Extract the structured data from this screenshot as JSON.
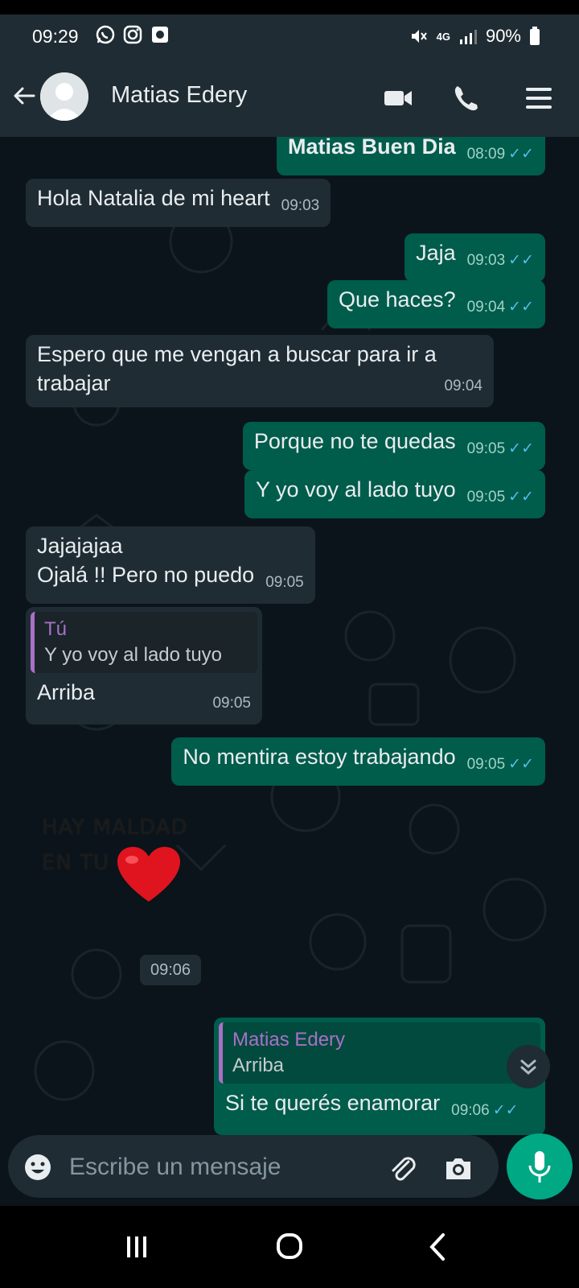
{
  "status_bar": {
    "time": "09:29",
    "network": "4G",
    "battery": "90%"
  },
  "header": {
    "contact_name": "Matias Edery"
  },
  "messages": [
    {
      "id": "m0",
      "direction": "out",
      "text": "Matias Buen Dia",
      "time": "08:09",
      "read": true
    },
    {
      "id": "m1",
      "direction": "in",
      "text": "Hola Natalia de mi heart",
      "time": "09:03"
    },
    {
      "id": "m2",
      "direction": "out",
      "text": "Jaja",
      "time": "09:03",
      "read": true
    },
    {
      "id": "m3",
      "direction": "out",
      "text": "Que haces?",
      "time": "09:04",
      "read": true
    },
    {
      "id": "m4",
      "direction": "in",
      "text": "Espero que me vengan a buscar para ir a trabajar",
      "time": "09:04"
    },
    {
      "id": "m5",
      "direction": "out",
      "text": "Porque no te quedas",
      "time": "09:05",
      "read": true
    },
    {
      "id": "m6",
      "direction": "out",
      "text": "Y yo voy al lado tuyo",
      "time": "09:05",
      "read": true
    },
    {
      "id": "m7",
      "direction": "in",
      "line1": "Jajajajaa",
      "line2": "Ojalá !! Pero no puedo",
      "time": "09:05"
    },
    {
      "id": "m8",
      "direction": "in",
      "quote_author": "Tú",
      "quote_text": "Y yo voy al lado tuyo",
      "text": "Arriba",
      "time": "09:05"
    },
    {
      "id": "m9",
      "direction": "out",
      "text": "No mentira estoy trabajando",
      "time": "09:05",
      "read": true
    },
    {
      "id": "m10",
      "direction": "out",
      "quote_author": "Matias Edery",
      "quote_text": "Arriba",
      "text": "Si te querés enamorar",
      "time": "09:06",
      "read": true
    }
  ],
  "sticker": {
    "line1": "HAY MALDAD",
    "line2": "EN TU",
    "time": "09:06"
  },
  "composer": {
    "placeholder": "Escribe un mensaje"
  },
  "colors": {
    "header_bg": "#1f2c34",
    "chat_bg": "#0b141a",
    "incoming_bubble": "#1f2c34",
    "outgoing_bubble": "#005c4b",
    "accent": "#00a884",
    "read_ticks": "#53bdeb",
    "quote_bar": "#a970c6"
  }
}
